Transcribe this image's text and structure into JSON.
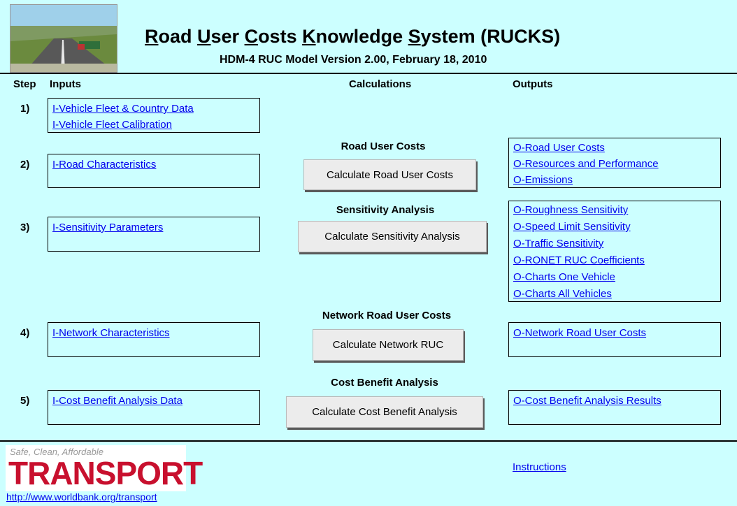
{
  "header": {
    "title_parts": [
      {
        "u": "R",
        "t": "oad "
      },
      {
        "u": "U",
        "t": "ser "
      },
      {
        "u": "C",
        "t": "osts "
      },
      {
        "u": "K",
        "t": "nowledge "
      },
      {
        "u": "S",
        "t": "ystem (RUCKS)"
      }
    ],
    "subtitle": "HDM-4 RUC Model Version 2.00, February 18, 2010"
  },
  "columns": {
    "step": "Step",
    "inputs": "Inputs",
    "calculations": "Calculations",
    "outputs": "Outputs"
  },
  "steps": [
    {
      "num": "1)",
      "inputs": [
        "I-Vehicle Fleet & Country Data",
        "I-Vehicle Fleet Calibration"
      ]
    },
    {
      "num": "2)",
      "inputs": [
        "I-Road Characteristics"
      ],
      "section": "Road User Costs",
      "button": "Calculate Road User Costs",
      "outputs": [
        "O-Road User Costs",
        "O-Resources and Performance",
        "O-Emissions"
      ]
    },
    {
      "num": "3)",
      "inputs": [
        "I-Sensitivity Parameters"
      ],
      "section": "Sensitivity Analysis",
      "button": "Calculate Sensitivity Analysis",
      "outputs": [
        "O-Roughness Sensitivity",
        "O-Speed Limit Sensitivity",
        "O-Traffic Sensitivity",
        "O-RONET RUC Coefficients",
        "O-Charts One Vehicle",
        "O-Charts All Vehicles"
      ]
    },
    {
      "num": "4)",
      "inputs": [
        "I-Network Characteristics"
      ],
      "section": "Network Road User Costs",
      "button": "Calculate Network RUC",
      "outputs": [
        "O-Network Road User Costs"
      ]
    },
    {
      "num": "5)",
      "inputs": [
        "I-Cost Benefit Analysis Data"
      ],
      "section": "Cost Benefit Analysis",
      "button": "Calculate Cost Benefit Analysis",
      "outputs": [
        "O-Cost Benefit Analysis Results"
      ]
    }
  ],
  "footer": {
    "logo_tagline": "Safe, Clean, Affordable",
    "logo_word": "TRANSPORT",
    "url": "http://www.worldbank.org/transport",
    "instructions": "Instructions"
  },
  "colors": {
    "background": "#ccffff",
    "link": "#0000ee",
    "logo_red": "#c8102e"
  }
}
